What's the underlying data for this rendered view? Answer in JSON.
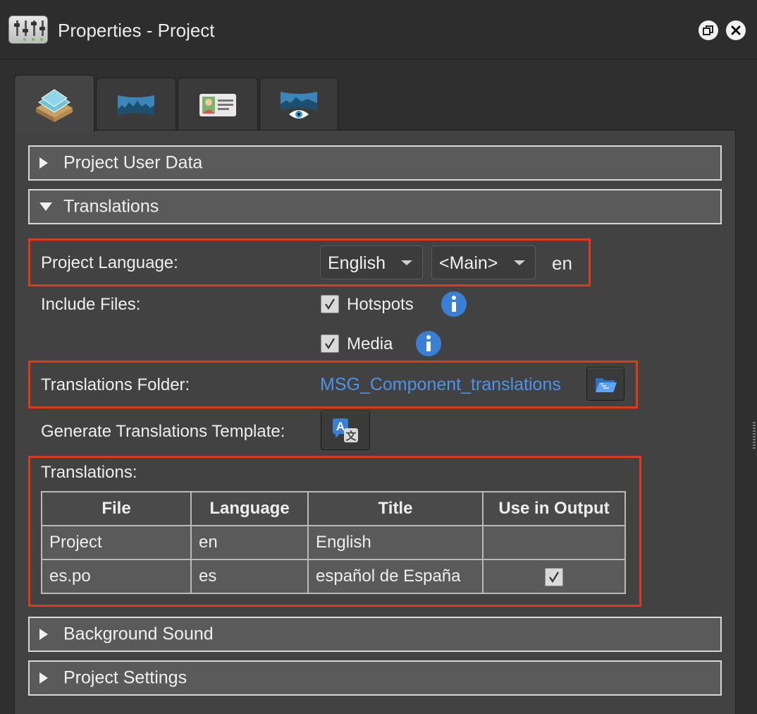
{
  "window": {
    "title": "Properties - Project",
    "icon": "mixer-sliders-icon",
    "buttons": [
      "restore-icon",
      "close-icon"
    ]
  },
  "tabs": [
    {
      "icon": "project-stack-icon",
      "active": true
    },
    {
      "icon": "panorama-icon",
      "active": false
    },
    {
      "icon": "user-card-icon",
      "active": false
    },
    {
      "icon": "panorama-view-icon",
      "active": false
    }
  ],
  "sections": {
    "user_data": {
      "label": "Project User Data",
      "expanded": false
    },
    "translations": {
      "label": "Translations",
      "expanded": true
    },
    "background_sound": {
      "label": "Background Sound",
      "expanded": false
    },
    "project_settings": {
      "label": "Project Settings",
      "expanded": false
    }
  },
  "translations_panel": {
    "project_language_label": "Project Language:",
    "language_select": "English",
    "variant_select": "<Main>",
    "language_code": "en",
    "include_files_label": "Include Files:",
    "hotspots_label": "Hotspots",
    "hotspots_checked": true,
    "media_label": "Media",
    "media_checked": true,
    "folder_label": "Translations Folder:",
    "folder_value": "MSG_Component_translations",
    "generate_label": "Generate Translations Template:",
    "table_label": "Translations:",
    "table": {
      "headers": [
        "File",
        "Language",
        "Title",
        "Use in Output"
      ],
      "rows": [
        {
          "file": "Project",
          "language": "en",
          "title": "English",
          "use": false
        },
        {
          "file": "es.po",
          "language": "es",
          "title": "español de España",
          "use": true
        }
      ]
    }
  },
  "colors": {
    "highlight": "#e03a1e",
    "link": "#4e93e6",
    "info": "#3a7fd6"
  }
}
